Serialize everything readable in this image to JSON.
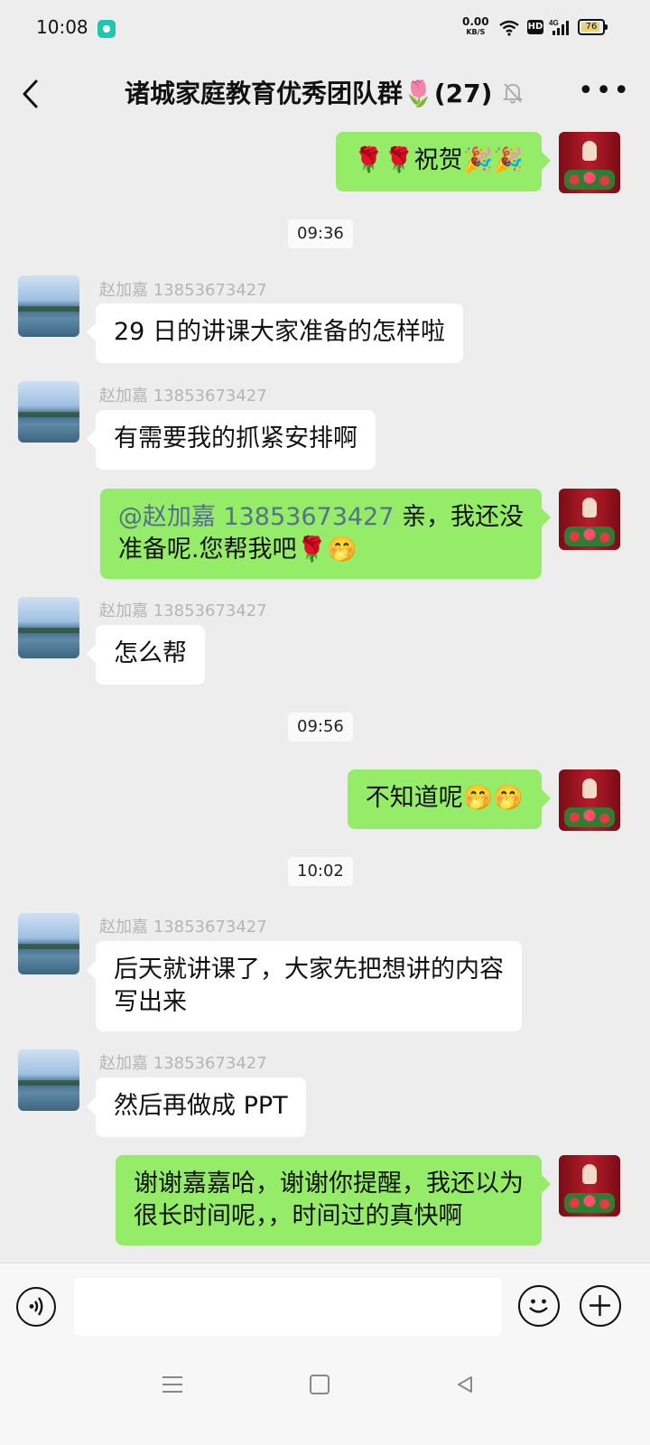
{
  "status_bar": {
    "time": "10:08",
    "net_speed_value": "0.00",
    "net_speed_unit": "KB/S",
    "hd_label": "HD",
    "signal_label": "4G",
    "battery_level": "76"
  },
  "header": {
    "title": "诸城家庭教育优秀团队群🌷(27)",
    "icons": [
      "back-icon",
      "mute-bell-icon",
      "more-icon"
    ]
  },
  "messages": [
    {
      "side": "out",
      "text": "🌹🌹祝贺🎉🎉"
    },
    {
      "timestamp": "09:36"
    },
    {
      "side": "in",
      "sender": "赵加嘉 13853673427",
      "text": "29 日的讲课大家准备的怎样啦"
    },
    {
      "side": "in",
      "sender": "赵加嘉 13853673427",
      "text": "有需要我的抓紧安排啊"
    },
    {
      "side": "out",
      "mention": "@赵加嘉 13853673427",
      "line1_rest": " 亲，我还没",
      "line2": "准备呢.您帮我吧🌹🤭"
    },
    {
      "side": "in",
      "sender": "赵加嘉 13853673427",
      "text": "怎么帮"
    },
    {
      "timestamp": "09:56"
    },
    {
      "side": "out",
      "text": "不知道呢🤭🤭"
    },
    {
      "timestamp": "10:02"
    },
    {
      "side": "in",
      "sender": "赵加嘉 13853673427",
      "line1": "后天就讲课了，大家先把想讲的内容",
      "line2": "写出来"
    },
    {
      "side": "in",
      "sender": "赵加嘉 13853673427",
      "text": "然后再做成 PPT"
    },
    {
      "side": "out",
      "line1": "谢谢嘉嘉哈，谢谢你提醒，我还以为",
      "line2": "很长时间呢，，时间过的真快啊"
    }
  ],
  "input_bar": {
    "value": "",
    "icons": [
      "voice-icon",
      "emoji-icon",
      "plus-icon"
    ]
  },
  "nav_bar": {
    "icons": [
      "menu-icon",
      "home-icon",
      "back-triangle-icon"
    ]
  }
}
